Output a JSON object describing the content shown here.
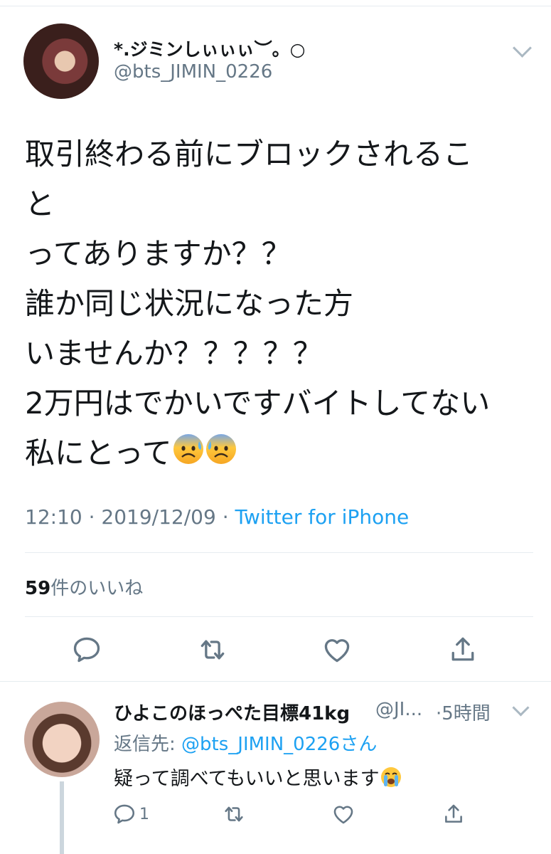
{
  "tweet": {
    "display_name": "*.ジミンしぃぃぃ︶。○",
    "handle": "@bts_JIMIN_0226",
    "body_lines": [
      "取引終わる前にブロックされるこ",
      "と",
      "ってありますか？？",
      "誰か同じ状況になった方",
      "いませんか？？？？？",
      "2万円はでかいですバイトしてない",
      "私にとって"
    ],
    "time": "12:10",
    "date": "2019/12/09",
    "source": "Twitter for iPhone",
    "likes_count": "59",
    "likes_label": "件のいいね"
  },
  "reply": {
    "display_name": "ひよこのほっぺた目標41kg",
    "handle": "@JI...",
    "time": "5時間",
    "reply_to_prefix": "返信先: ",
    "reply_to_handle": "@bts_JIMIN_0226さん",
    "text": "疑って調べてもいいと思います",
    "reply_count": "1"
  },
  "icons": [
    "chevron-down-icon",
    "reply-icon",
    "retweet-icon",
    "like-icon",
    "share-icon",
    "anxious-sweat-emoji",
    "crying-emoji"
  ],
  "colors": {
    "link": "#1da1f2",
    "secondary_text": "#657786",
    "primary_text": "#14171a",
    "divider": "#e6ecf0"
  }
}
